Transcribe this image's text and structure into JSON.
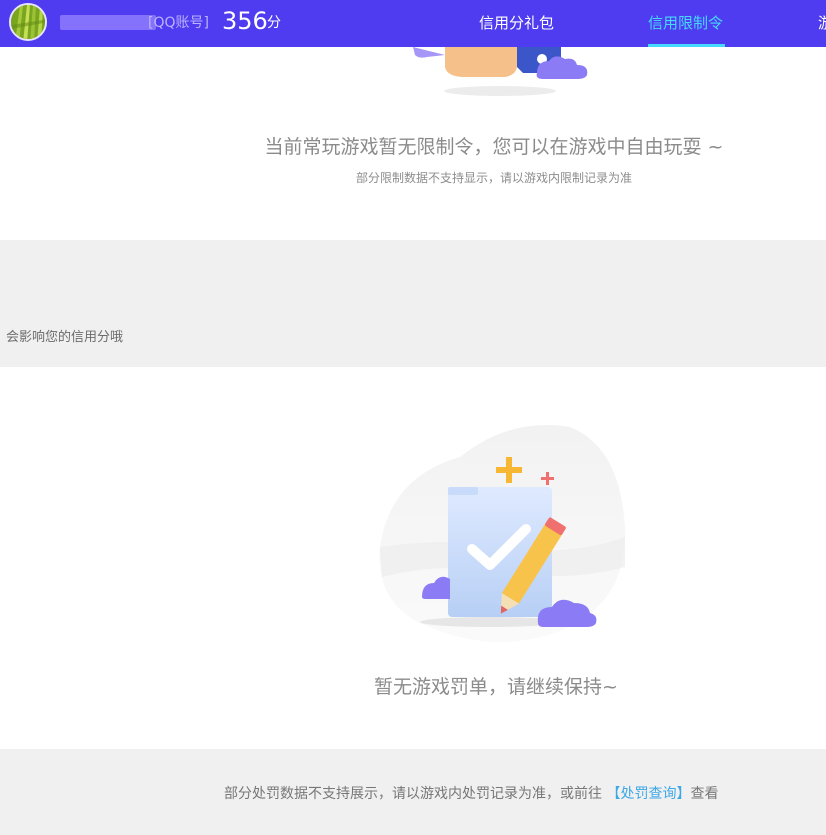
{
  "header": {
    "account_type": "[QQ账号]",
    "score_value": "356",
    "score_unit": "分",
    "nav": {
      "gift": "信用分礼包",
      "limit": "信用限制令",
      "cut": "游"
    },
    "colors": {
      "background": "#4f3bf0",
      "active_tab": "#45d9ff"
    }
  },
  "restriction": {
    "message": "当前常玩游戏暂无限制令，您可以在游戏中自由玩耍 ~",
    "note": "部分限制数据不支持显示，请以游戏内限制记录为准"
  },
  "penalty_header": {
    "text": "会影响您的信用分哦"
  },
  "penalty": {
    "message": "暂无游戏罚单，请继续保持~",
    "footer_prefix": "部分处罚数据不支持展示，请以游戏内处罚记录为准，或前往 ",
    "footer_link": "【处罚查询】",
    "footer_suffix": "查看"
  }
}
